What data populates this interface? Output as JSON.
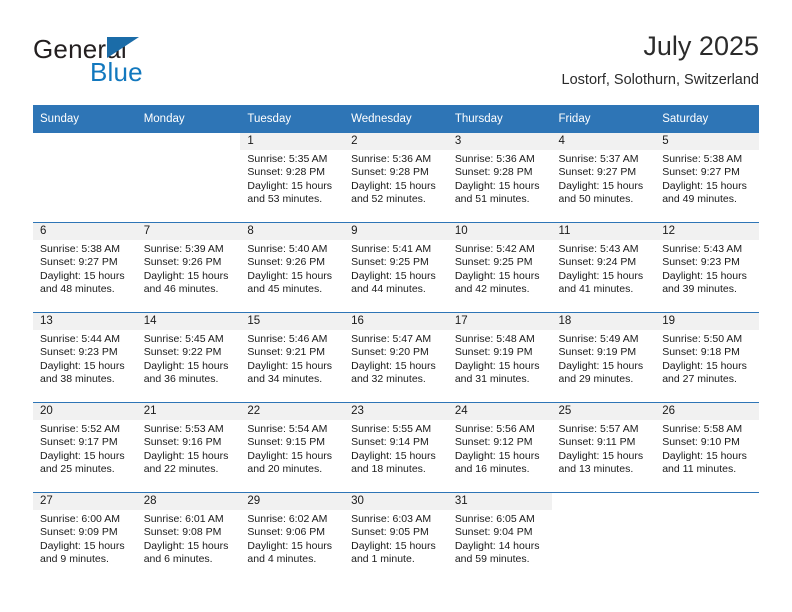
{
  "brand": {
    "name_top": "General",
    "name_bottom": "Blue",
    "accent_color": "#1278be",
    "triangle_color": "#1b6ca8"
  },
  "header": {
    "title": "July 2025",
    "location": "Lostorf, Solothurn, Switzerland"
  },
  "theme": {
    "header_row_bg": "#2e75b6",
    "daynum_band_bg": "#f1f1f1",
    "row_divider": "#2e75b6",
    "text": "#1a1a1a"
  },
  "weekdays": [
    "Sunday",
    "Monday",
    "Tuesday",
    "Wednesday",
    "Thursday",
    "Friday",
    "Saturday"
  ],
  "weeks": [
    [
      {
        "day": "",
        "sunrise": "",
        "sunset": "",
        "daylight1": "",
        "daylight2": ""
      },
      {
        "day": "",
        "sunrise": "",
        "sunset": "",
        "daylight1": "",
        "daylight2": ""
      },
      {
        "day": "1",
        "sunrise": "Sunrise: 5:35 AM",
        "sunset": "Sunset: 9:28 PM",
        "daylight1": "Daylight: 15 hours",
        "daylight2": "and 53 minutes."
      },
      {
        "day": "2",
        "sunrise": "Sunrise: 5:36 AM",
        "sunset": "Sunset: 9:28 PM",
        "daylight1": "Daylight: 15 hours",
        "daylight2": "and 52 minutes."
      },
      {
        "day": "3",
        "sunrise": "Sunrise: 5:36 AM",
        "sunset": "Sunset: 9:28 PM",
        "daylight1": "Daylight: 15 hours",
        "daylight2": "and 51 minutes."
      },
      {
        "day": "4",
        "sunrise": "Sunrise: 5:37 AM",
        "sunset": "Sunset: 9:27 PM",
        "daylight1": "Daylight: 15 hours",
        "daylight2": "and 50 minutes."
      },
      {
        "day": "5",
        "sunrise": "Sunrise: 5:38 AM",
        "sunset": "Sunset: 9:27 PM",
        "daylight1": "Daylight: 15 hours",
        "daylight2": "and 49 minutes."
      }
    ],
    [
      {
        "day": "6",
        "sunrise": "Sunrise: 5:38 AM",
        "sunset": "Sunset: 9:27 PM",
        "daylight1": "Daylight: 15 hours",
        "daylight2": "and 48 minutes."
      },
      {
        "day": "7",
        "sunrise": "Sunrise: 5:39 AM",
        "sunset": "Sunset: 9:26 PM",
        "daylight1": "Daylight: 15 hours",
        "daylight2": "and 46 minutes."
      },
      {
        "day": "8",
        "sunrise": "Sunrise: 5:40 AM",
        "sunset": "Sunset: 9:26 PM",
        "daylight1": "Daylight: 15 hours",
        "daylight2": "and 45 minutes."
      },
      {
        "day": "9",
        "sunrise": "Sunrise: 5:41 AM",
        "sunset": "Sunset: 9:25 PM",
        "daylight1": "Daylight: 15 hours",
        "daylight2": "and 44 minutes."
      },
      {
        "day": "10",
        "sunrise": "Sunrise: 5:42 AM",
        "sunset": "Sunset: 9:25 PM",
        "daylight1": "Daylight: 15 hours",
        "daylight2": "and 42 minutes."
      },
      {
        "day": "11",
        "sunrise": "Sunrise: 5:43 AM",
        "sunset": "Sunset: 9:24 PM",
        "daylight1": "Daylight: 15 hours",
        "daylight2": "and 41 minutes."
      },
      {
        "day": "12",
        "sunrise": "Sunrise: 5:43 AM",
        "sunset": "Sunset: 9:23 PM",
        "daylight1": "Daylight: 15 hours",
        "daylight2": "and 39 minutes."
      }
    ],
    [
      {
        "day": "13",
        "sunrise": "Sunrise: 5:44 AM",
        "sunset": "Sunset: 9:23 PM",
        "daylight1": "Daylight: 15 hours",
        "daylight2": "and 38 minutes."
      },
      {
        "day": "14",
        "sunrise": "Sunrise: 5:45 AM",
        "sunset": "Sunset: 9:22 PM",
        "daylight1": "Daylight: 15 hours",
        "daylight2": "and 36 minutes."
      },
      {
        "day": "15",
        "sunrise": "Sunrise: 5:46 AM",
        "sunset": "Sunset: 9:21 PM",
        "daylight1": "Daylight: 15 hours",
        "daylight2": "and 34 minutes."
      },
      {
        "day": "16",
        "sunrise": "Sunrise: 5:47 AM",
        "sunset": "Sunset: 9:20 PM",
        "daylight1": "Daylight: 15 hours",
        "daylight2": "and 32 minutes."
      },
      {
        "day": "17",
        "sunrise": "Sunrise: 5:48 AM",
        "sunset": "Sunset: 9:19 PM",
        "daylight1": "Daylight: 15 hours",
        "daylight2": "and 31 minutes."
      },
      {
        "day": "18",
        "sunrise": "Sunrise: 5:49 AM",
        "sunset": "Sunset: 9:19 PM",
        "daylight1": "Daylight: 15 hours",
        "daylight2": "and 29 minutes."
      },
      {
        "day": "19",
        "sunrise": "Sunrise: 5:50 AM",
        "sunset": "Sunset: 9:18 PM",
        "daylight1": "Daylight: 15 hours",
        "daylight2": "and 27 minutes."
      }
    ],
    [
      {
        "day": "20",
        "sunrise": "Sunrise: 5:52 AM",
        "sunset": "Sunset: 9:17 PM",
        "daylight1": "Daylight: 15 hours",
        "daylight2": "and 25 minutes."
      },
      {
        "day": "21",
        "sunrise": "Sunrise: 5:53 AM",
        "sunset": "Sunset: 9:16 PM",
        "daylight1": "Daylight: 15 hours",
        "daylight2": "and 22 minutes."
      },
      {
        "day": "22",
        "sunrise": "Sunrise: 5:54 AM",
        "sunset": "Sunset: 9:15 PM",
        "daylight1": "Daylight: 15 hours",
        "daylight2": "and 20 minutes."
      },
      {
        "day": "23",
        "sunrise": "Sunrise: 5:55 AM",
        "sunset": "Sunset: 9:14 PM",
        "daylight1": "Daylight: 15 hours",
        "daylight2": "and 18 minutes."
      },
      {
        "day": "24",
        "sunrise": "Sunrise: 5:56 AM",
        "sunset": "Sunset: 9:12 PM",
        "daylight1": "Daylight: 15 hours",
        "daylight2": "and 16 minutes."
      },
      {
        "day": "25",
        "sunrise": "Sunrise: 5:57 AM",
        "sunset": "Sunset: 9:11 PM",
        "daylight1": "Daylight: 15 hours",
        "daylight2": "and 13 minutes."
      },
      {
        "day": "26",
        "sunrise": "Sunrise: 5:58 AM",
        "sunset": "Sunset: 9:10 PM",
        "daylight1": "Daylight: 15 hours",
        "daylight2": "and 11 minutes."
      }
    ],
    [
      {
        "day": "27",
        "sunrise": "Sunrise: 6:00 AM",
        "sunset": "Sunset: 9:09 PM",
        "daylight1": "Daylight: 15 hours",
        "daylight2": "and 9 minutes."
      },
      {
        "day": "28",
        "sunrise": "Sunrise: 6:01 AM",
        "sunset": "Sunset: 9:08 PM",
        "daylight1": "Daylight: 15 hours",
        "daylight2": "and 6 minutes."
      },
      {
        "day": "29",
        "sunrise": "Sunrise: 6:02 AM",
        "sunset": "Sunset: 9:06 PM",
        "daylight1": "Daylight: 15 hours",
        "daylight2": "and 4 minutes."
      },
      {
        "day": "30",
        "sunrise": "Sunrise: 6:03 AM",
        "sunset": "Sunset: 9:05 PM",
        "daylight1": "Daylight: 15 hours",
        "daylight2": "and 1 minute."
      },
      {
        "day": "31",
        "sunrise": "Sunrise: 6:05 AM",
        "sunset": "Sunset: 9:04 PM",
        "daylight1": "Daylight: 14 hours",
        "daylight2": "and 59 minutes."
      },
      {
        "day": "",
        "sunrise": "",
        "sunset": "",
        "daylight1": "",
        "daylight2": ""
      },
      {
        "day": "",
        "sunrise": "",
        "sunset": "",
        "daylight1": "",
        "daylight2": ""
      }
    ]
  ]
}
